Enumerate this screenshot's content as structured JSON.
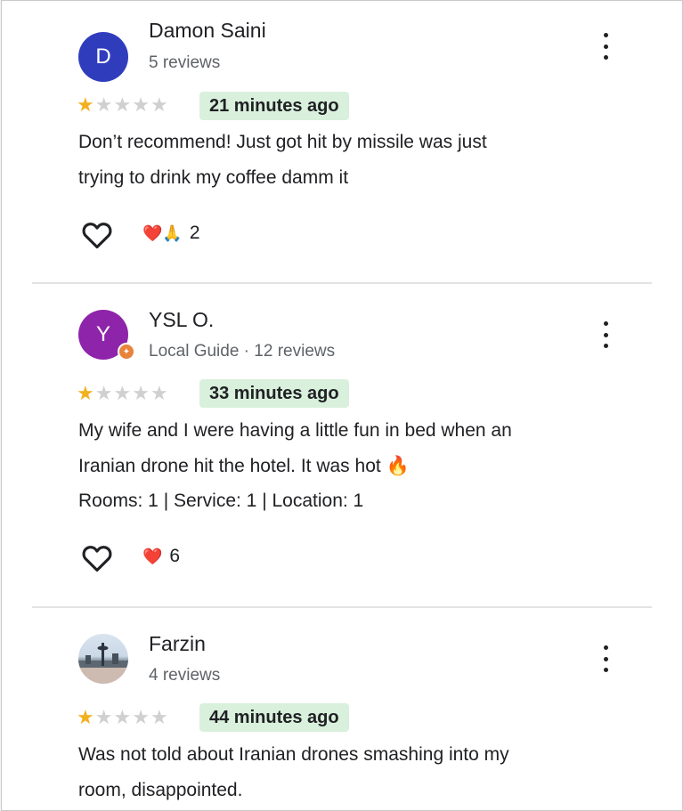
{
  "reviews": [
    {
      "avatar_letter": "D",
      "avatar_color": "#2f3dbd",
      "name": "Damon Saini",
      "subtitle": "5 reviews",
      "stars": 1,
      "time": "21 minutes ago",
      "body_line1": "Don’t recommend! Just got hit by missile was just",
      "body_line2": "trying to drink my coffee damm it",
      "reaction_emojis": "❤️🙏",
      "reaction_count": "2"
    },
    {
      "avatar_letter": "Y",
      "avatar_color": "#8e24aa",
      "local_guide_badge_color": "#e8833a",
      "name": "YSL O.",
      "subtitle": "Local Guide · 12 reviews",
      "stars": 1,
      "time": "33 minutes ago",
      "body_line1": "My wife and I were having a little fun in bed when an",
      "body_line2": "Iranian drone hit the hotel. It was hot 🔥",
      "ratings": "Rooms: 1 | Service: 1 | Location: 1",
      "reaction_emojis": "❤️",
      "reaction_count": "6"
    },
    {
      "avatar_type": "photo",
      "name": "Farzin",
      "subtitle": "4 reviews",
      "stars": 1,
      "time": "44 minutes ago",
      "body_line1": "Was not told about Iranian drones smashing into my",
      "body_line2": "room, disappointed."
    }
  ],
  "icons": {
    "heart_button": "heart-outline-icon",
    "more_menu": "more-vert-icon",
    "star": "star-icon"
  },
  "colors": {
    "star_filled": "#f2b01e",
    "star_empty": "#d0d0d0",
    "time_badge_bg": "#d9f0dc"
  }
}
